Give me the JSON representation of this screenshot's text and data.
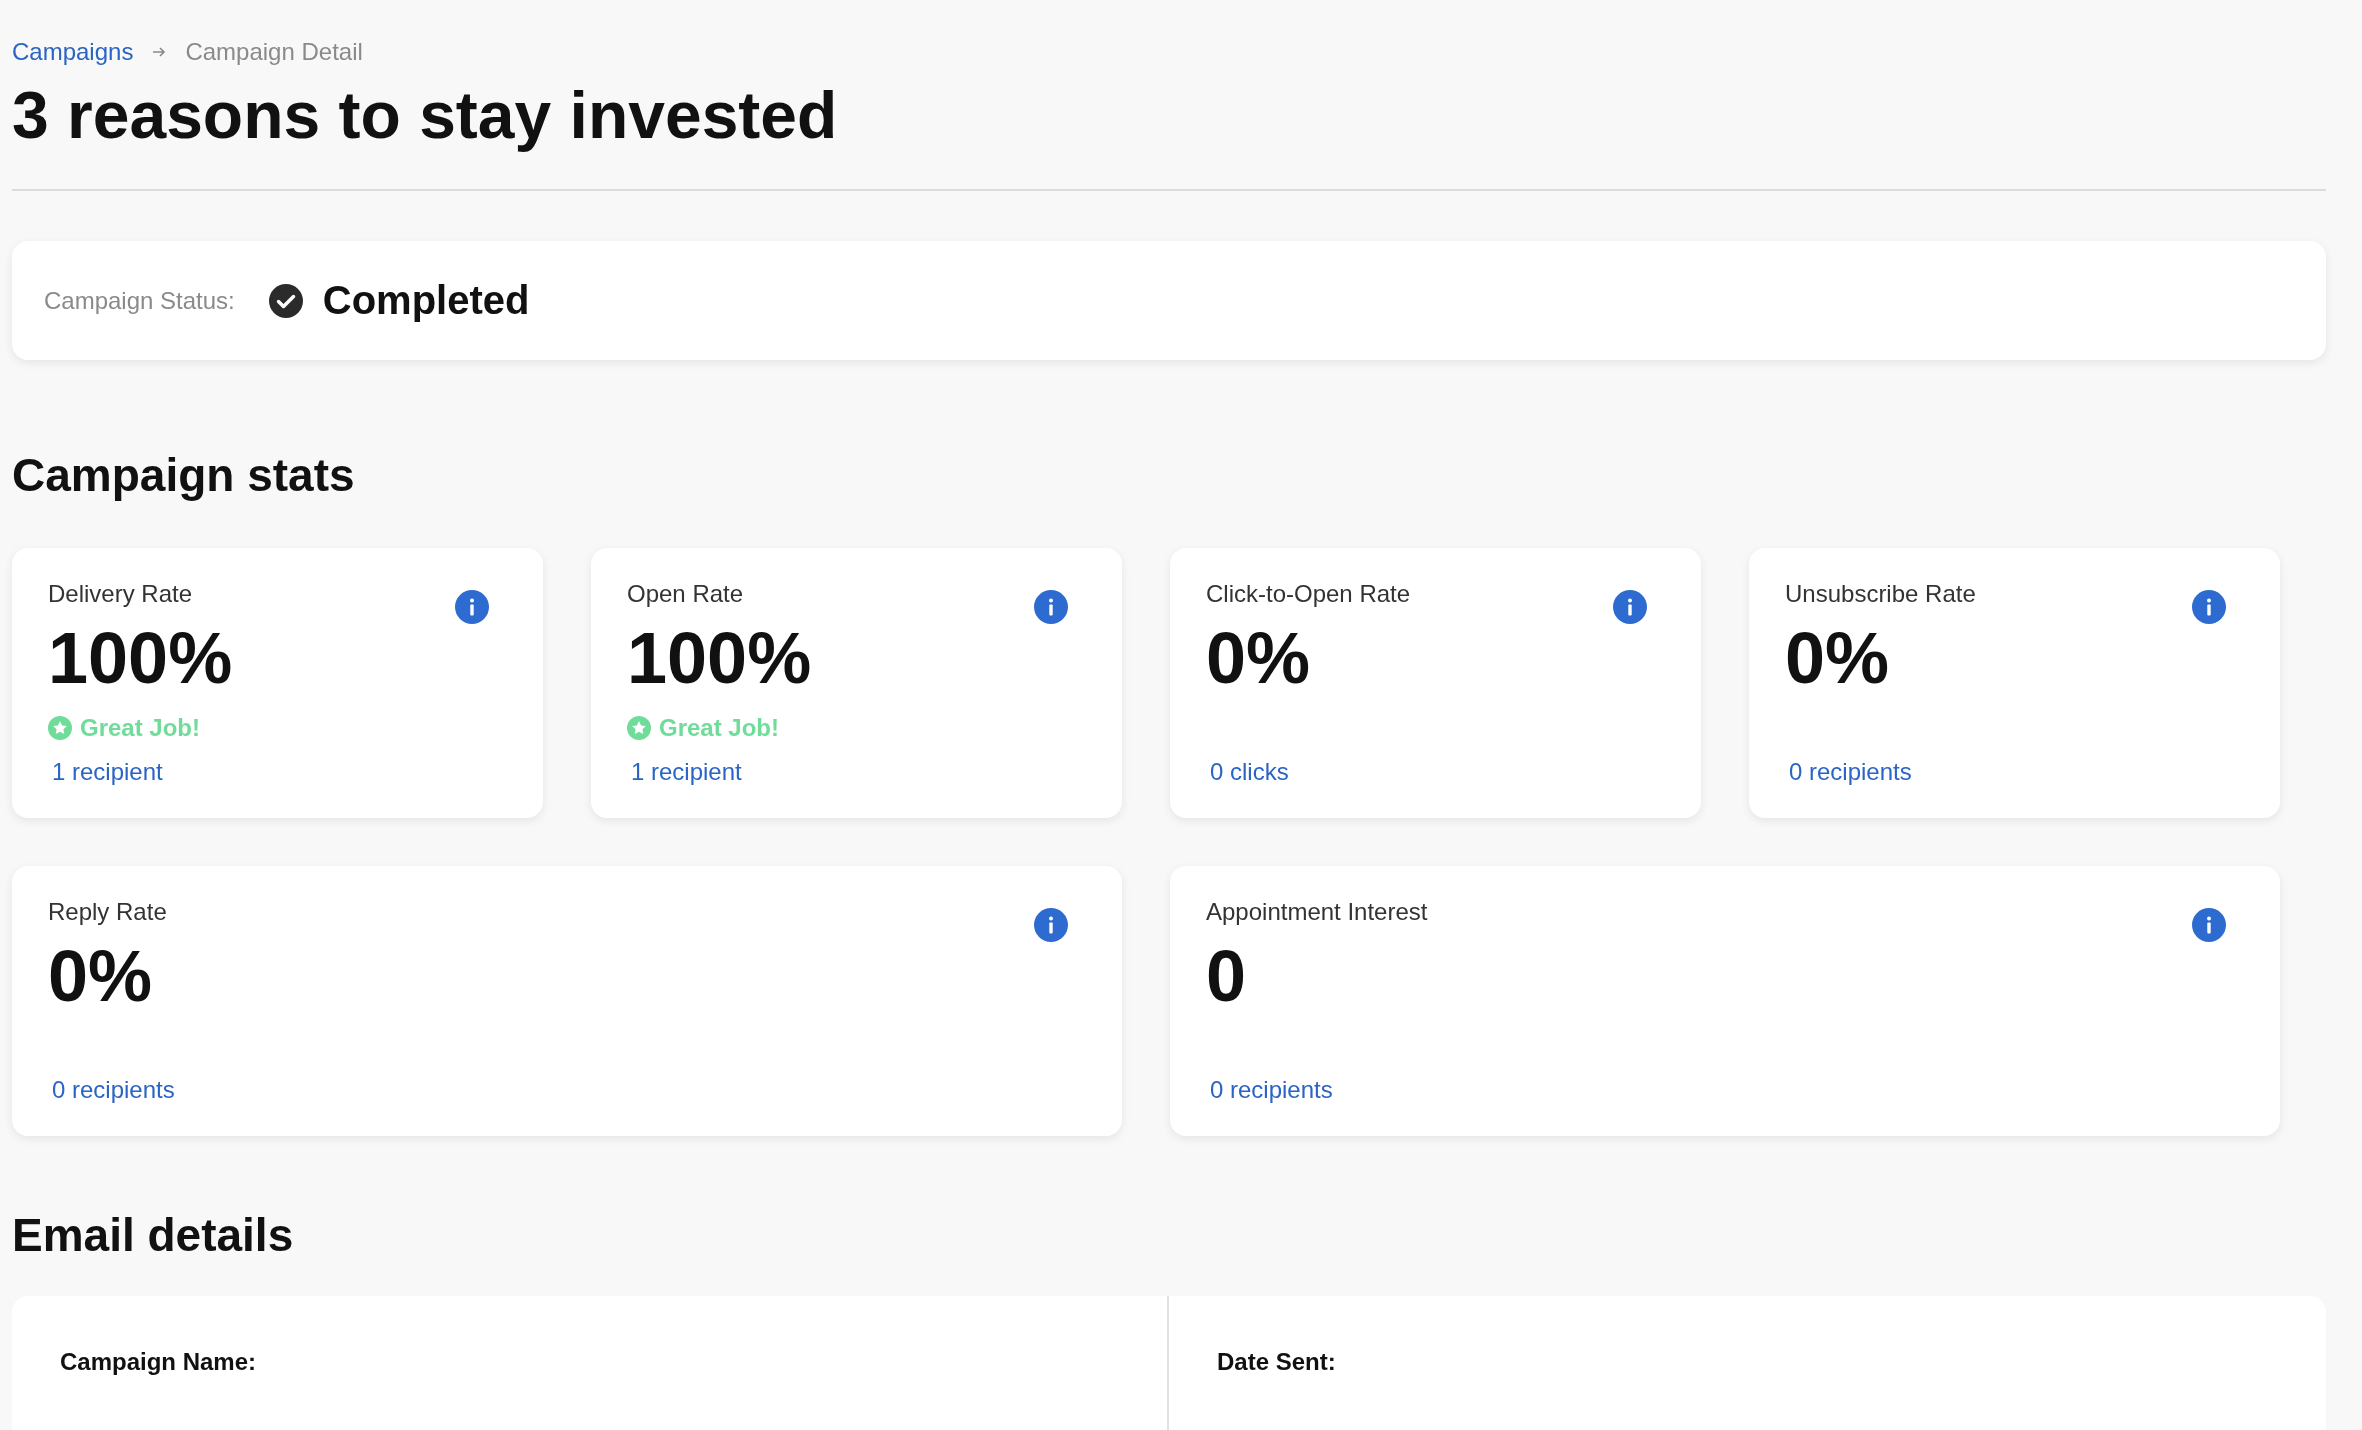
{
  "breadcrumb": {
    "parent": "Campaigns",
    "current": "Campaign Detail"
  },
  "title": "3 reasons to stay invested",
  "status": {
    "label": "Campaign Status:",
    "value": "Completed"
  },
  "stats": {
    "heading": "Campaign stats",
    "rows": [
      {
        "cards": [
          {
            "label": "Delivery Rate",
            "value": "100%",
            "badge": "Great Job!",
            "link": "1 recipient"
          },
          {
            "label": "Open Rate",
            "value": "100%",
            "badge": "Great Job!",
            "link": "1 recipient"
          },
          {
            "label": "Click-to-Open Rate",
            "value": "0%",
            "link": "0 clicks"
          },
          {
            "label": "Unsubscribe Rate",
            "value": "0%",
            "link": "0 recipients"
          }
        ]
      },
      {
        "cards": [
          {
            "label": "Reply Rate",
            "value": "0%",
            "link": "0 recipients"
          },
          {
            "label": "Appointment Interest",
            "value": "0",
            "link": "0 recipients"
          }
        ]
      }
    ]
  },
  "email_details": {
    "heading": "Email details",
    "fields": [
      {
        "label": "Campaign Name:"
      },
      {
        "label": "Date Sent:"
      }
    ]
  }
}
